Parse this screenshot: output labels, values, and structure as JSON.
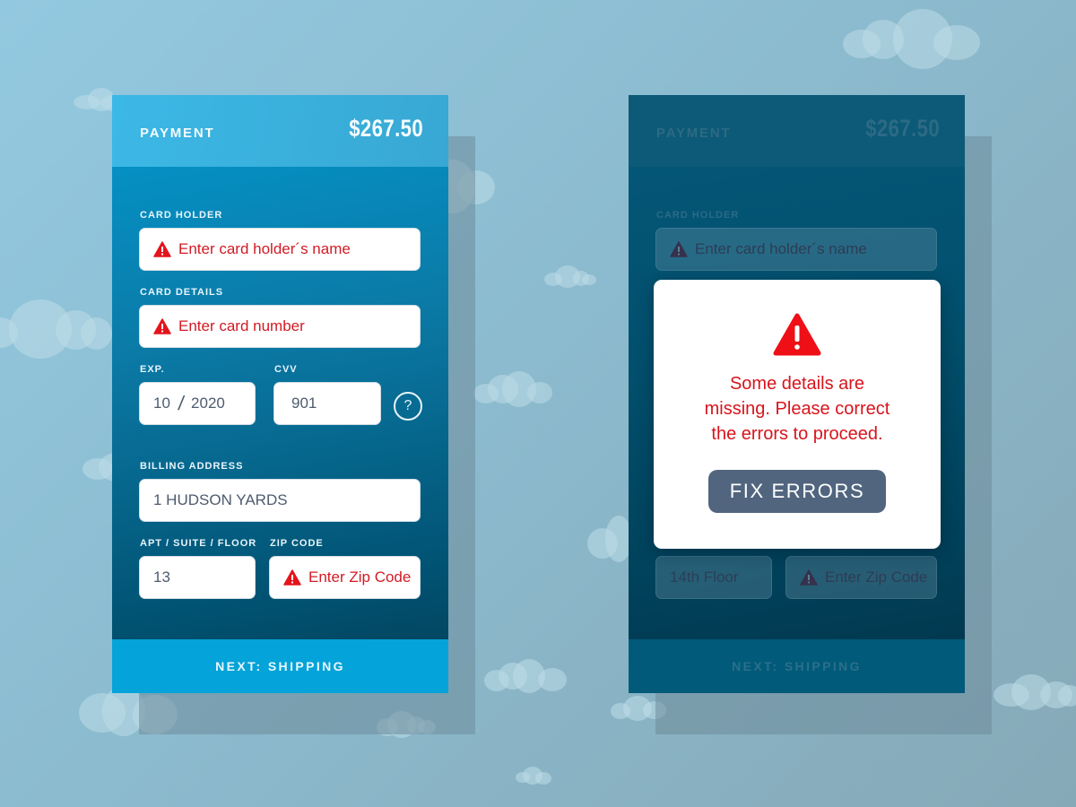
{
  "colors": {
    "error_red": "#d8141c",
    "accent_blue": "#04a3d9",
    "modal_button": "#51657f"
  },
  "left_screen": {
    "header": {
      "title": "PAYMENT",
      "amount": "$267.50"
    },
    "card_holder": {
      "label": "CARD HOLDER",
      "error": "Enter card holder´s name",
      "icon": "warning-triangle-icon"
    },
    "card_details": {
      "label": "CARD DETAILS",
      "error": "Enter card number",
      "icon": "warning-triangle-icon"
    },
    "expiry": {
      "label": "EXP.",
      "month": "10",
      "separator": "/",
      "year": "2020"
    },
    "cvv": {
      "label": "CVV",
      "value": "901",
      "help_icon": "question-circle-icon",
      "help_text": "?"
    },
    "billing_address": {
      "label": "BILLING ADDRESS",
      "value": "1 HUDSON YARDS"
    },
    "apt": {
      "label": "APT / SUITE / FLOOR",
      "value": "13"
    },
    "zip": {
      "label": "ZIP CODE",
      "error": "Enter Zip Code",
      "icon": "warning-triangle-icon"
    },
    "footer_button": "NEXT: SHIPPING"
  },
  "right_screen": {
    "header": {
      "title": "PAYMENT",
      "amount": "$267.50"
    },
    "card_holder": {
      "label": "CARD HOLDER",
      "error": "Enter card holder´s name"
    },
    "apt": {
      "value": "14th Floor"
    },
    "zip": {
      "error": "Enter Zip Code"
    },
    "footer_button": "NEXT: SHIPPING",
    "modal": {
      "icon": "warning-triangle-icon",
      "message_lines": [
        "Some details are",
        "missing. Please correct",
        "the errors to proceed."
      ],
      "button": "FIX ERRORS"
    }
  }
}
